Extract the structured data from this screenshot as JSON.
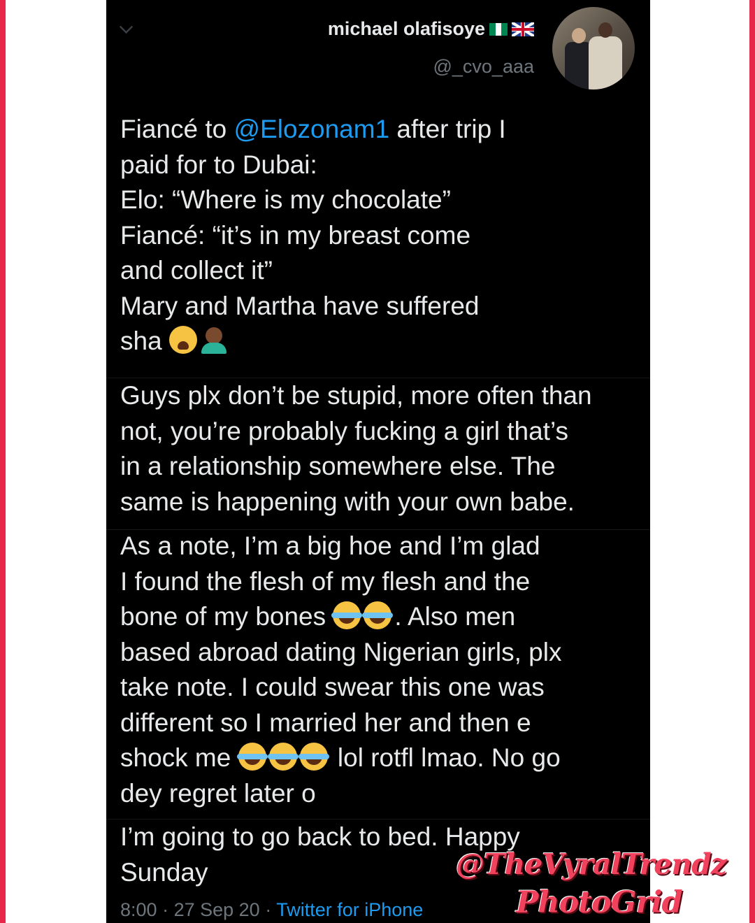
{
  "tweet": {
    "author_name": "michael olafisoye",
    "author_handle": "@_cvo_aaa",
    "author_flags": [
      "flag-nigeria-icon",
      "flag-uk-icon"
    ],
    "paragraph1": {
      "line1_pre": "Fiancé to ",
      "mention": "@Elozonam1",
      "line1_post": " after trip I",
      "rest": "paid for to Dubai:\nElo: “Where is my chocolate”\nFiancé: “it’s in my breast come\nand collect it”\nMary and Martha have suffered\nsha "
    },
    "paragraph2": "Guys plx don’t be stupid, more often than\nnot, you’re probably fucking a girl that’s\nin a relationship somewhere else. The\nsame is happening with your own babe.",
    "paragraph3": {
      "part1": "As a note, I’m a big hoe and I’m glad\nI found the flesh of my flesh and the\nbone of my bones ",
      "part2": ". Also men\nbased abroad dating Nigerian girls, plx\ntake note. I could swear this one was\ndifferent so I married her and then e\nshock me ",
      "part3": " lol rotfl lmao. No go\ndey regret later o"
    },
    "paragraph4": "I’m going to go back to bed. Happy\nSunday",
    "time": "8:00",
    "date": "27 Sep 20",
    "separator": "·",
    "client": "Twitter for iPhone"
  },
  "watermark": {
    "line1": "@TheVyralTrendz",
    "line2": "PhotoGrid"
  },
  "colors": {
    "background": "#000000",
    "text": "#e7e9ea",
    "secondary": "#6e767d",
    "link": "#1d9bf0",
    "frame": "#e8284a",
    "watermark": "#f0425c"
  }
}
